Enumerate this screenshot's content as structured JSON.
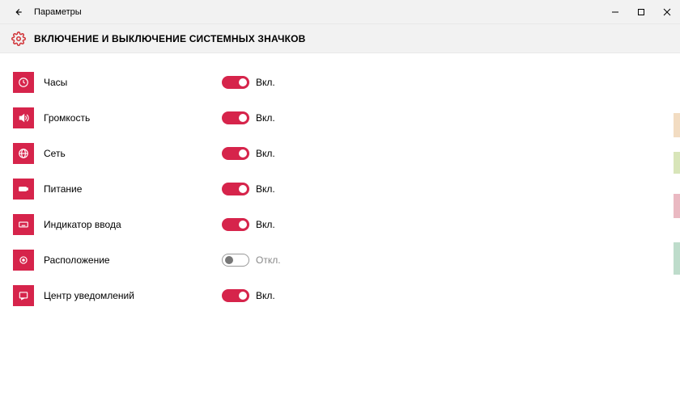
{
  "window": {
    "title": "Параметры"
  },
  "page": {
    "heading": "ВКЛЮЧЕНИЕ И ВЫКЛЮЧЕНИЕ СИСТЕМНЫХ ЗНАЧКОВ"
  },
  "labels": {
    "on": "Вкл.",
    "off": "Откл."
  },
  "items": [
    {
      "icon": "clock",
      "label": "Часы",
      "on": true
    },
    {
      "icon": "volume",
      "label": "Громкость",
      "on": true
    },
    {
      "icon": "network",
      "label": "Сеть",
      "on": true
    },
    {
      "icon": "battery",
      "label": "Питание",
      "on": true
    },
    {
      "icon": "input",
      "label": "Индикатор ввода",
      "on": true
    },
    {
      "icon": "location",
      "label": "Расположение",
      "on": false
    },
    {
      "icon": "action",
      "label": "Центр уведомлений",
      "on": true
    }
  ]
}
